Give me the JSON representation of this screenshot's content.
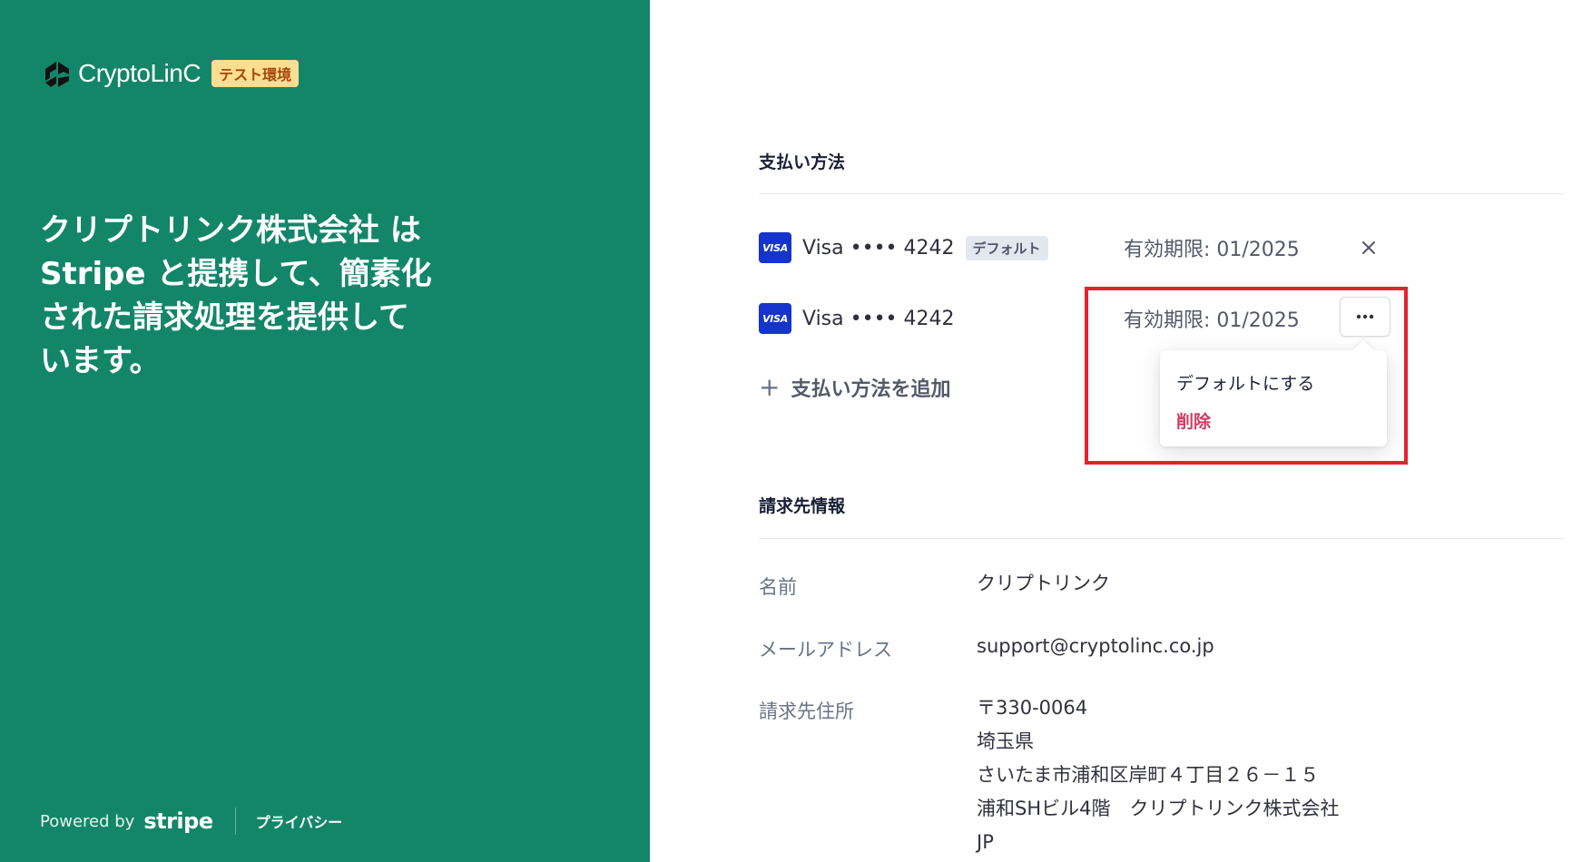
{
  "brand": {
    "name": "CryptoLinC",
    "env_badge": "テスト環境",
    "headline": "クリプトリンク株式会社 は Stripe と提携して、簡素化された請求処理を提供しています。"
  },
  "footer": {
    "powered_by": "Powered by",
    "stripe": "stripe",
    "privacy": "プライバシー"
  },
  "payment_methods": {
    "title": "支払い方法",
    "cards": [
      {
        "brand_label": "VISA",
        "text": "Visa •••• 4242",
        "badge": "デフォルト",
        "expiry": "有効期限: 01/2025"
      },
      {
        "brand_label": "VISA",
        "text": "Visa •••• 4242",
        "expiry": "有効期限: 01/2025"
      }
    ],
    "add_label": "支払い方法を追加",
    "menu": {
      "make_default": "デフォルトにする",
      "delete": "削除"
    }
  },
  "billing": {
    "title": "請求先情報",
    "name_label": "名前",
    "name_value": "クリプトリンク",
    "email_label": "メールアドレス",
    "email_value": "support@cryptolinc.co.jp",
    "address_label": "請求先住所",
    "address_lines": [
      "〒330-0064",
      "埼玉県",
      "さいたま市浦和区岸町４丁目２６－１５",
      "浦和SHビル4階　クリプトリンク株式会社",
      "JP"
    ]
  },
  "colors": {
    "brand_green": "#138669",
    "visa_blue": "#1434cb",
    "delete_red": "#cd3d64",
    "highlight_red": "#e3222d",
    "env_badge_bg": "#ffde92"
  }
}
